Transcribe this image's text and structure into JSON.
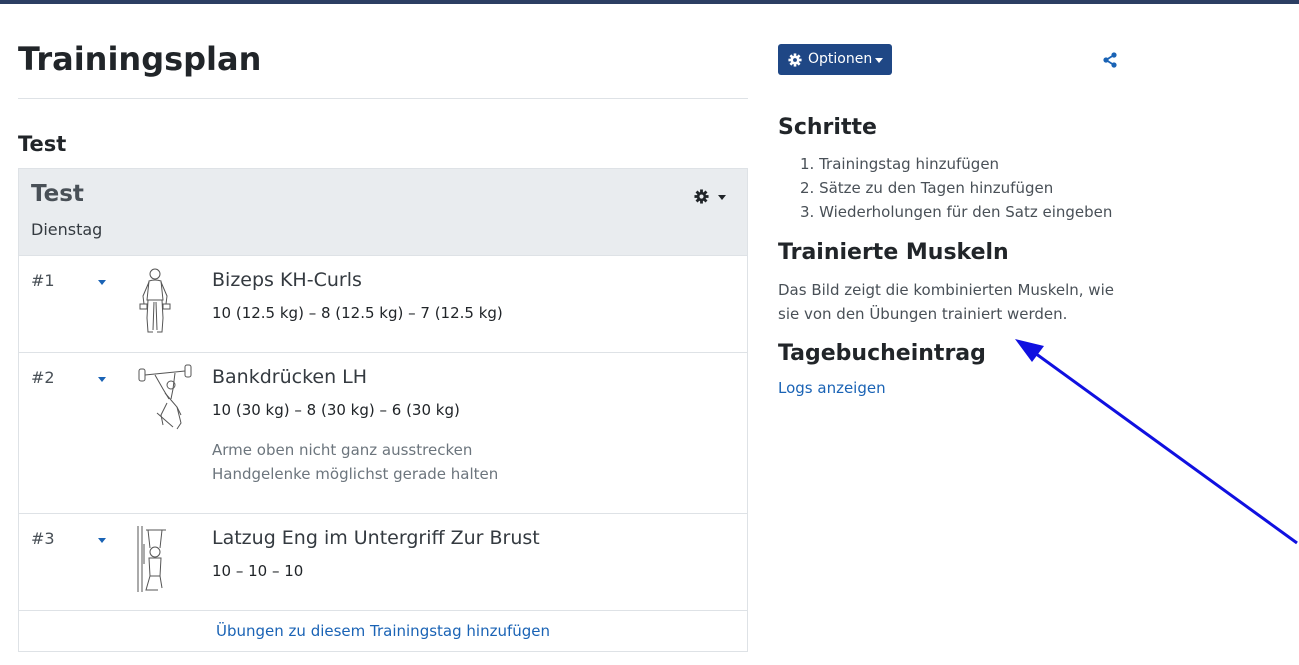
{
  "colors": {
    "topbar": "#2c3e63",
    "accent": "#1a63b5",
    "button": "#1f4785",
    "arrow": "#1010e0"
  },
  "page": {
    "title": "Trainingsplan"
  },
  "plan": {
    "name": "Test",
    "day": {
      "title": "Test",
      "weekday": "Dienstag",
      "options_icon": "gear-icon",
      "exercises": [
        {
          "num": "#1",
          "name": "Bizeps KH-Curls",
          "sets": "10 (12.5 kg) – 8 (12.5 kg) – 7 (12.5 kg)",
          "notes": []
        },
        {
          "num": "#2",
          "name": "Bankdrücken LH",
          "sets": "10 (30 kg) – 8 (30 kg) – 6 (30 kg)",
          "notes": [
            "Arme oben nicht ganz ausstrecken",
            "Handgelenke möglichst gerade halten"
          ]
        },
        {
          "num": "#3",
          "name": "Latzug Eng im Untergriff Zur Brust",
          "sets": "10 – 10 – 10",
          "notes": []
        }
      ],
      "add_exercises_link": "Übungen zu diesem Trainingstag hinzufügen"
    }
  },
  "sidebar": {
    "options_button": "Optionen",
    "share_icon": "share-icon",
    "steps_heading": "Schritte",
    "steps": [
      "1. Trainingstag hinzufügen",
      "2. Sätze zu den Tagen hinzufügen",
      "3. Wiederholungen für den Satz eingeben"
    ],
    "muscles_heading": "Trainierte Muskeln",
    "muscles_text": "Das Bild zeigt die kombinierten Muskeln, wie sie von den Übungen trainiert werden.",
    "log_heading": "Tagebucheintrag",
    "log_link": "Logs anzeigen"
  }
}
